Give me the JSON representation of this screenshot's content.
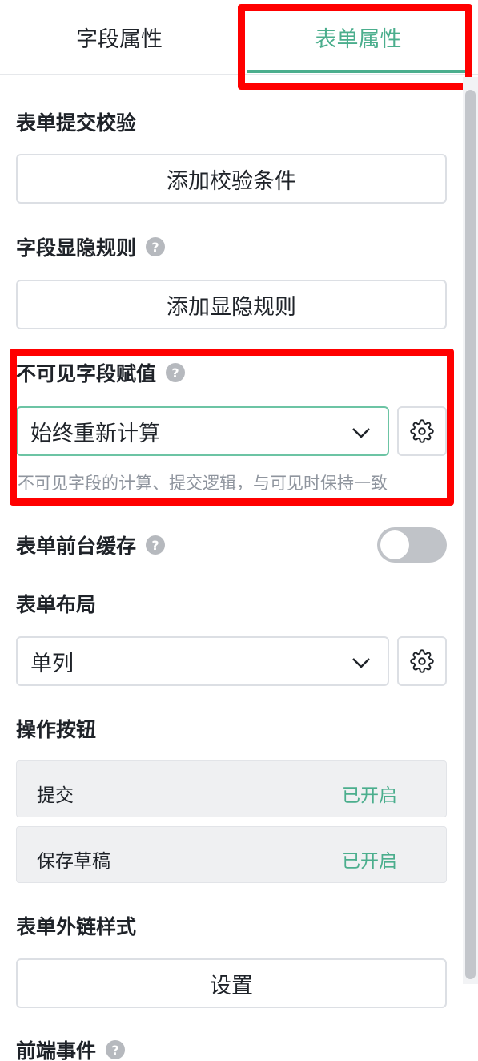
{
  "tabs": {
    "field_properties": "字段属性",
    "form_properties": "表单属性"
  },
  "sections": {
    "submit_validation": {
      "title": "表单提交校验",
      "button": "添加校验条件"
    },
    "visibility_rules": {
      "title": "字段显隐规则",
      "button": "添加显隐规则"
    },
    "invisible_assignment": {
      "title": "不可见字段赋值",
      "selected": "始终重新计算",
      "hint": "不可见字段的计算、提交逻辑，与可见时保持一致"
    },
    "frontend_cache": {
      "title": "表单前台缓存",
      "enabled": false
    },
    "layout": {
      "title": "表单布局",
      "selected": "单列"
    },
    "action_buttons": {
      "title": "操作按钮",
      "items": [
        {
          "label": "提交",
          "status": "已开启"
        },
        {
          "label": "保存草稿",
          "status": "已开启"
        }
      ]
    },
    "external_link_style": {
      "title": "表单外链样式",
      "button": "设置"
    },
    "frontend_events": {
      "title": "前端事件"
    }
  },
  "icons": {
    "help": "?",
    "chevron": "chevron-down-icon",
    "gear": "gear-icon"
  },
  "colors": {
    "accent": "#4bae8d",
    "highlight": "#ff0000"
  }
}
